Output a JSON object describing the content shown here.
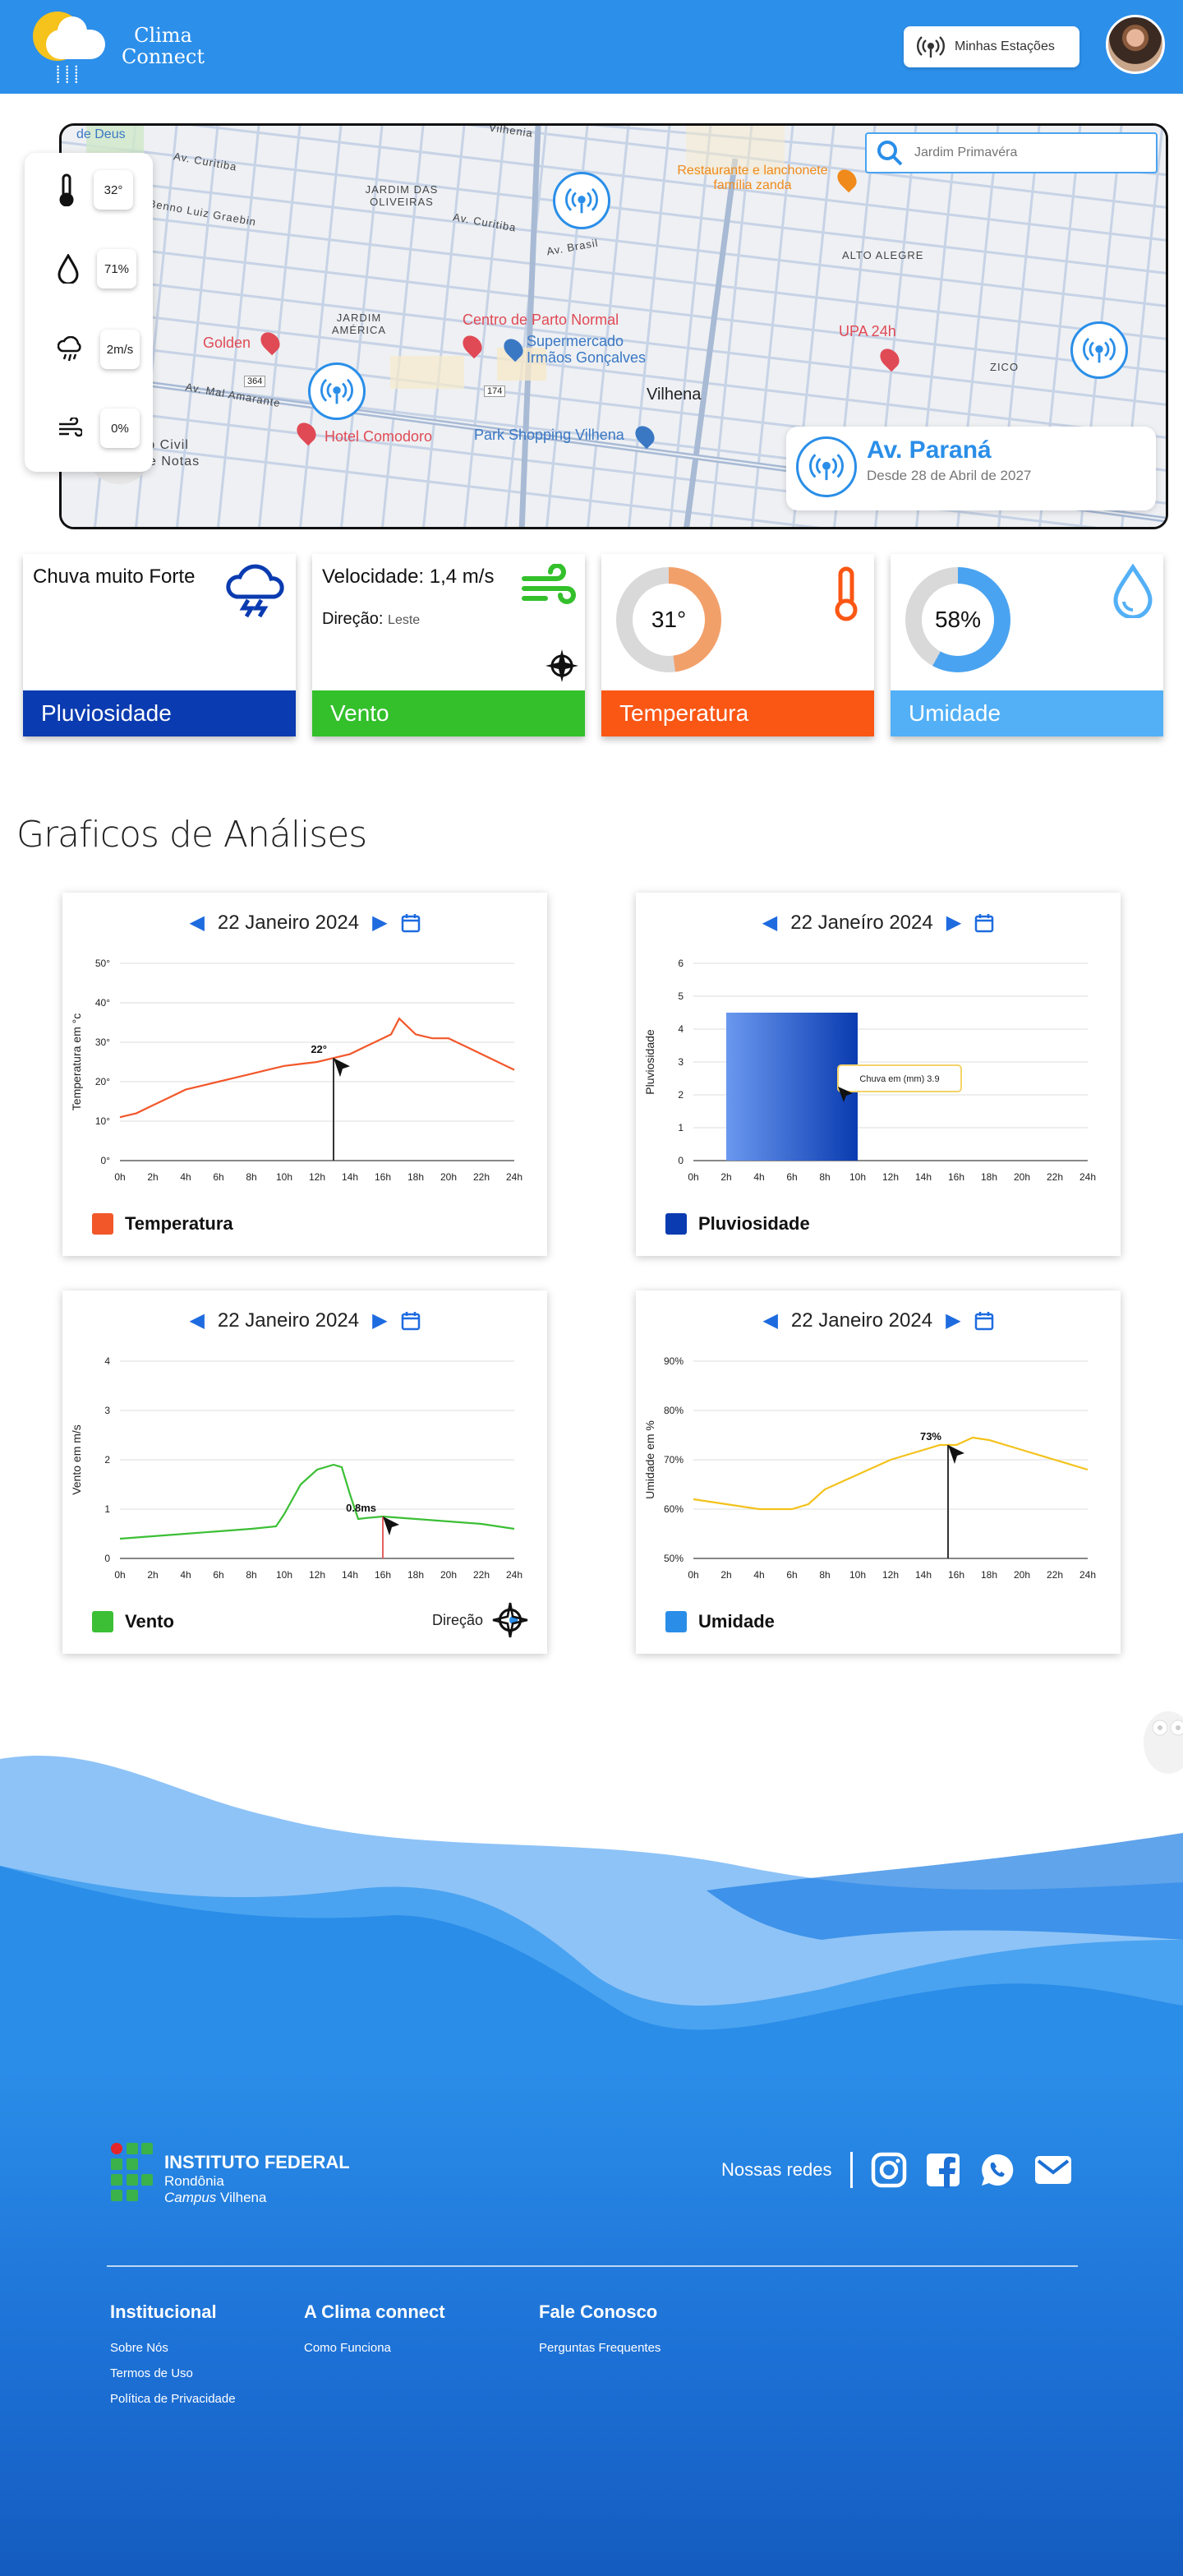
{
  "header": {
    "logo_line1": "Clima",
    "logo_line2": "Connect",
    "stations_button": "Minhas Estações",
    "colors": {
      "primary": "#2c8fea"
    }
  },
  "map": {
    "search_placeholder": "Jardim Primavéra",
    "labels": {
      "de_deus": "de Deus",
      "hilenia": "Vilhenia",
      "av_curitiba": "Av. Curitiba",
      "jardim_oliveiras": "JARDIM DAS OLIVEIRAS",
      "av_benno": "Av. Benno Luiz Graebin",
      "av_curitiba_2": "Av. Curitiba",
      "av_brasil": "Av. Brasil",
      "restaurante": "Restaurante e lanchonete família zanda",
      "alto_alegre": "ALTO ALEGRE",
      "jardim_america": "JARDIM AMÉRICA",
      "centro_parto": "Centro de Parto Normal",
      "golden": "Golden",
      "supermercado": "Supermercado Irmãos Gonçalves",
      "upa": "UPA 24h",
      "zico": "ZICO",
      "av_mai": "Av. Mal Amarante",
      "vilhena": "Vilhena",
      "hotel": "Hotel Comodoro",
      "park_shopping": "Park Shopping Vilhena",
      "civil": "ro Civil",
      "notas": "e Notas",
      "r364": "364",
      "r174": "174"
    },
    "station": {
      "name": "Av. Paraná",
      "since": "Desde 28 de Abril de 2027"
    },
    "quick": {
      "temperature": "32°",
      "humidity": "71%",
      "wind": "2m/s",
      "rain": "0%"
    }
  },
  "cards": {
    "rain": {
      "title": "Chuva muito Forte",
      "footer": "Pluviosidade",
      "color": "#0a3bb0"
    },
    "wind": {
      "speed_label": "Velocidade: 1,4 m/s",
      "direction_label": "Direção:",
      "direction_value": "Leste",
      "footer": "Vento",
      "color": "#33c02b"
    },
    "temp": {
      "value": "31°",
      "percent": 0.48,
      "footer": "Temperatura",
      "color": "#fa5614"
    },
    "humidity": {
      "value": "58%",
      "percent": 0.58,
      "footer": "Umidade",
      "color": "#53b0f6"
    }
  },
  "section": {
    "title": "Graficos de Análises"
  },
  "charts": {
    "date": "22 Janeiro 2024",
    "date_alt": "22 Janeíro 2024",
    "x_ticks": [
      "0h",
      "2h",
      "4h",
      "6h",
      "8h",
      "10h",
      "12h",
      "14h",
      "16h",
      "18h",
      "20h",
      "22h",
      "24h"
    ]
  },
  "chart_data": [
    {
      "type": "line",
      "ylabel": "Temperatura em °c",
      "yticks": [
        "0°",
        "10°",
        "20°",
        "30°",
        "40°",
        "50°"
      ],
      "ylim": [
        0,
        50
      ],
      "x": [
        0,
        1,
        2,
        3,
        4,
        5,
        6,
        7,
        8,
        9,
        10,
        11,
        12,
        13,
        14,
        15,
        16,
        16.5,
        17,
        17.5,
        18,
        19,
        20,
        21,
        22,
        23,
        24
      ],
      "y": [
        11,
        12,
        14,
        16,
        18,
        19,
        20,
        21,
        22,
        23,
        24,
        24.5,
        25,
        26,
        27,
        29,
        31,
        32,
        36,
        34,
        32,
        31,
        31,
        29,
        27,
        25,
        23
      ],
      "annotation": "22°",
      "marker_x": 13,
      "color": "#f2572a",
      "legend": "Temperatura"
    },
    {
      "type": "bar",
      "ylabel": "Pluviosidade",
      "yticks": [
        "0",
        "1",
        "2",
        "3",
        "4",
        "5",
        "6"
      ],
      "ylim": [
        0,
        6
      ],
      "bar_x": [
        2,
        10
      ],
      "bar_value": 4.5,
      "tooltip": "Chuva em (mm) 3.9",
      "color": "#1d52d6",
      "legend": "Pluviosidade"
    },
    {
      "type": "line",
      "ylabel": "Vento em m/s",
      "yticks": [
        "0",
        "1",
        "2",
        "3",
        "4"
      ],
      "ylim": [
        0,
        4
      ],
      "x": [
        0,
        2,
        4,
        6,
        8,
        9.5,
        10,
        11,
        12,
        13,
        13.5,
        14,
        14.5,
        15,
        16,
        18,
        20,
        22,
        24
      ],
      "y": [
        0.4,
        0.45,
        0.5,
        0.55,
        0.6,
        0.65,
        0.9,
        1.5,
        1.8,
        1.9,
        1.85,
        1.3,
        0.8,
        0.82,
        0.85,
        0.8,
        0.75,
        0.7,
        0.6
      ],
      "annotation": "0.8ms",
      "marker_x": 16,
      "color": "#3cbf35",
      "legend": "Vento",
      "direction_label": "Direção"
    },
    {
      "type": "line",
      "ylabel": "Umidade em %",
      "yticks": [
        "50%",
        "60%",
        "70%",
        "80%",
        "90%"
      ],
      "ylim": [
        50,
        90
      ],
      "x": [
        0,
        2,
        4,
        6,
        7,
        8,
        10,
        12,
        14,
        15,
        16,
        17,
        18,
        20,
        22,
        24
      ],
      "y": [
        62,
        61,
        60,
        60,
        61,
        64,
        67,
        70,
        72,
        73,
        73,
        74.5,
        74,
        72,
        70,
        68
      ],
      "annotation": "73%",
      "marker_x": 15.5,
      "color": "#f3c21b",
      "legend": "Umidade"
    }
  ],
  "footer": {
    "institute": "INSTITUTO FEDERAL",
    "state": "Rondônia",
    "campus_word": "Campus",
    "campus_city": "Vilhena",
    "social_label": "Nossas redes",
    "cols": [
      {
        "title": "Institucional",
        "links": [
          "Sobre Nós",
          "Termos de Uso",
          "Política de Privacidade"
        ]
      },
      {
        "title": "A Clima connect",
        "links": [
          "Como Funciona"
        ]
      },
      {
        "title": "Fale Conosco",
        "links": [
          "Perguntas Frequentes"
        ]
      }
    ]
  }
}
